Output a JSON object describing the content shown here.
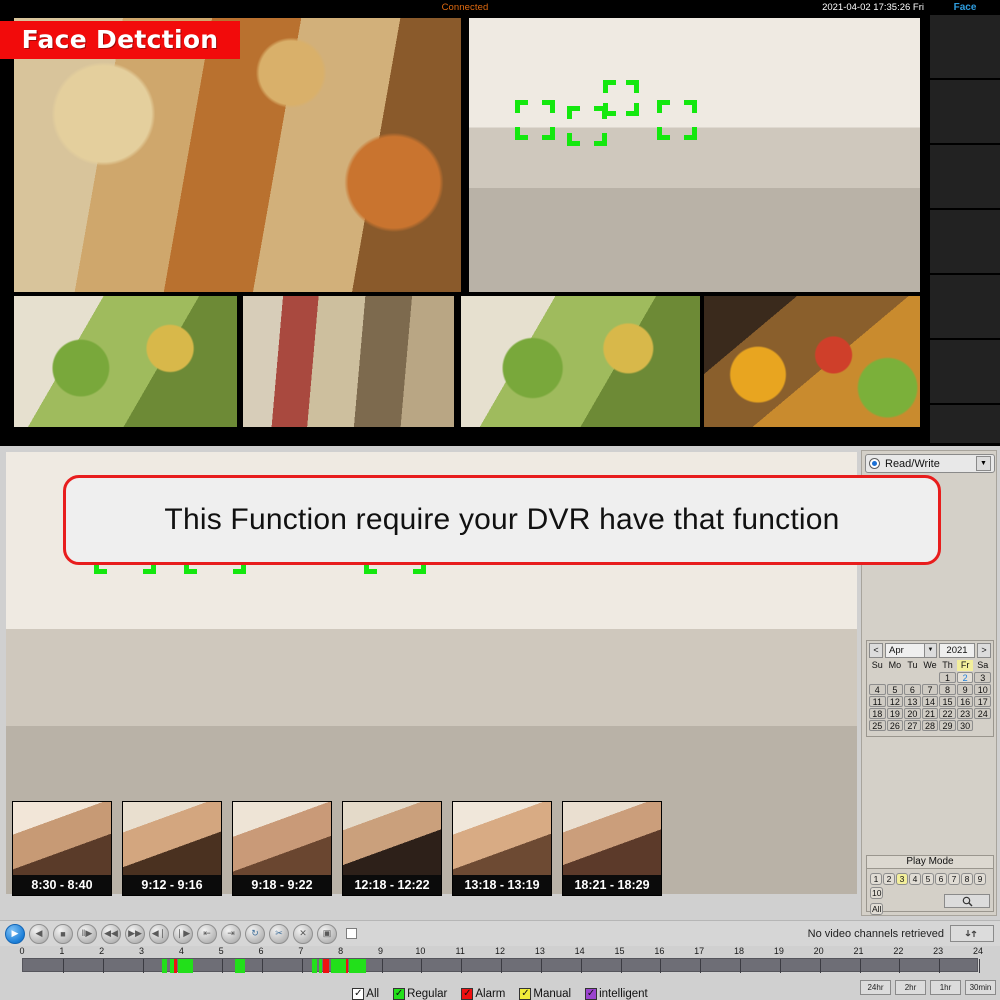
{
  "window": {
    "status_text": "Connected",
    "datetime": "2021-04-02 17:35:26 Fri",
    "face_tab_label": "Face"
  },
  "live_view": {
    "banner_label": "Face Detction",
    "banner_color": "#f20b0b",
    "detection_box_color": "#14e80f",
    "cells": [
      {
        "id": 1,
        "scene": "supermarket-shopper-aisle",
        "faces_detected": 0
      },
      {
        "id": 2,
        "scene": "street-pedestrians",
        "faces_detected": 4
      },
      {
        "id": 3,
        "scene": "woman-with-grocery-bag",
        "faces_detected": 0
      },
      {
        "id": 4,
        "scene": "woman-shopping-aisle",
        "faces_detected": 0
      },
      {
        "id": 5,
        "scene": "woman-vegetable-section",
        "faces_detected": 0
      },
      {
        "id": 6,
        "scene": "woman-fruit-market",
        "faces_detected": 0
      }
    ]
  },
  "face_sidebar": {
    "title": "Face",
    "thumbnails": [
      {
        "label": "face-capture-1"
      },
      {
        "label": "face-capture-2"
      },
      {
        "label": "face-capture-3"
      },
      {
        "label": "face-capture-4"
      },
      {
        "label": "face-capture-5"
      },
      {
        "label": "face-capture-6"
      },
      {
        "label": "face-capture-7"
      }
    ]
  },
  "playback": {
    "message": "This Function require your DVR have that function",
    "message_border_color": "#e81d1d",
    "detected_faces": 4,
    "face_results": [
      {
        "time_range": "8:30 - 8:40"
      },
      {
        "time_range": "9:12 - 9:16"
      },
      {
        "time_range": "9:18 - 9:22"
      },
      {
        "time_range": "12:18 - 12:22"
      },
      {
        "time_range": "13:18 - 13:19"
      },
      {
        "time_range": "18:21 - 18:29"
      }
    ]
  },
  "right_panel": {
    "stream_mode": "Read/Write",
    "calendar": {
      "prev_label": "<",
      "next_label": ">",
      "month": "Apr",
      "year": "2021",
      "day_headers": [
        "Su",
        "Mo",
        "Tu",
        "We",
        "Th",
        "Fr",
        "Sa"
      ],
      "highlighted_day_header": "Fr",
      "selected_day": "2",
      "leading_blanks": 4,
      "days": [
        1,
        2,
        3,
        4,
        5,
        6,
        7,
        8,
        9,
        10,
        11,
        12,
        13,
        14,
        15,
        16,
        17,
        18,
        19,
        20,
        21,
        22,
        23,
        24,
        25,
        26,
        27,
        28,
        29,
        30
      ]
    },
    "play_mode": {
      "title": "Play Mode",
      "channels": [
        "1",
        "2",
        "3",
        "4",
        "5",
        "6",
        "7",
        "8",
        "9",
        "10"
      ],
      "all_label": "All",
      "active_channel": "3",
      "search_icon": "magnifier-icon"
    }
  },
  "toolbar": {
    "buttons": [
      {
        "name": "play-button",
        "glyph": "▶",
        "active": true
      },
      {
        "name": "reverse-play-button",
        "glyph": "◀",
        "active": false
      },
      {
        "name": "stop-button",
        "glyph": "■",
        "active": false
      },
      {
        "name": "slow-forward-button",
        "glyph": "‖▶",
        "active": false
      },
      {
        "name": "rewind-button",
        "glyph": "◀◀",
        "active": false
      },
      {
        "name": "fast-forward-button",
        "glyph": "▶▶",
        "active": false
      },
      {
        "name": "previous-frame-button",
        "glyph": "◀❘",
        "active": false
      },
      {
        "name": "next-frame-button",
        "glyph": "❘▶",
        "active": false
      },
      {
        "name": "jump-backward-button",
        "glyph": "⇤",
        "active": false
      },
      {
        "name": "jump-forward-button",
        "glyph": "⇥",
        "active": false
      },
      {
        "name": "loop-playback-button",
        "glyph": "↻",
        "active": false,
        "tint": true
      },
      {
        "name": "clip-button",
        "glyph": "✂",
        "active": false,
        "tint": true
      },
      {
        "name": "cut-button",
        "glyph": "✕",
        "active": false
      },
      {
        "name": "save-button",
        "glyph": "▣",
        "active": false
      }
    ],
    "sync_checkbox_label": "sync-checkbox",
    "status": "No video channels retrieved",
    "refresh_icon": "refresh-arrows-icon"
  },
  "timeline": {
    "hour_ticks": [
      "0",
      "1",
      "2",
      "3",
      "4",
      "5",
      "6",
      "7",
      "8",
      "9",
      "10",
      "11",
      "12",
      "13",
      "14",
      "15",
      "16",
      "17",
      "18",
      "19",
      "20",
      "21",
      "22",
      "23",
      "24"
    ],
    "range_hours": [
      0,
      24
    ],
    "segments": [
      {
        "type": "Regular",
        "color": "#22e01a",
        "start_hour": 3.48,
        "end_hour": 3.62
      },
      {
        "type": "Regular",
        "color": "#22e01a",
        "start_hour": 3.68,
        "end_hour": 3.8
      },
      {
        "type": "Alarm",
        "color": "#ee1111",
        "start_hour": 3.8,
        "end_hour": 3.86
      },
      {
        "type": "Regular",
        "color": "#22e01a",
        "start_hour": 3.9,
        "end_hour": 4.28
      },
      {
        "type": "Regular",
        "color": "#22e01a",
        "start_hour": 5.33,
        "end_hour": 5.58
      },
      {
        "type": "Regular",
        "color": "#22e01a",
        "start_hour": 7.26,
        "end_hour": 7.38
      },
      {
        "type": "Regular",
        "color": "#22e01a",
        "start_hour": 7.42,
        "end_hour": 7.5
      },
      {
        "type": "Alarm",
        "color": "#ee1111",
        "start_hour": 7.53,
        "end_hour": 7.68
      },
      {
        "type": "Regular",
        "color": "#22e01a",
        "start_hour": 7.72,
        "end_hour": 8.1
      },
      {
        "type": "Alarm",
        "color": "#ee1111",
        "start_hour": 8.1,
        "end_hour": 8.14
      },
      {
        "type": "Regular",
        "color": "#22e01a",
        "start_hour": 8.18,
        "end_hour": 8.62
      }
    ],
    "legend": [
      {
        "label": "All",
        "color": "#ffffff"
      },
      {
        "label": "Regular",
        "color": "#22e01a"
      },
      {
        "label": "Alarm",
        "color": "#ee1111"
      },
      {
        "label": "Manual",
        "color": "#f0ec3a"
      },
      {
        "label": "intelligent",
        "color": "#9b44cf"
      }
    ],
    "zoom_buttons": [
      "24hr",
      "2hr",
      "1hr",
      "30min"
    ]
  }
}
